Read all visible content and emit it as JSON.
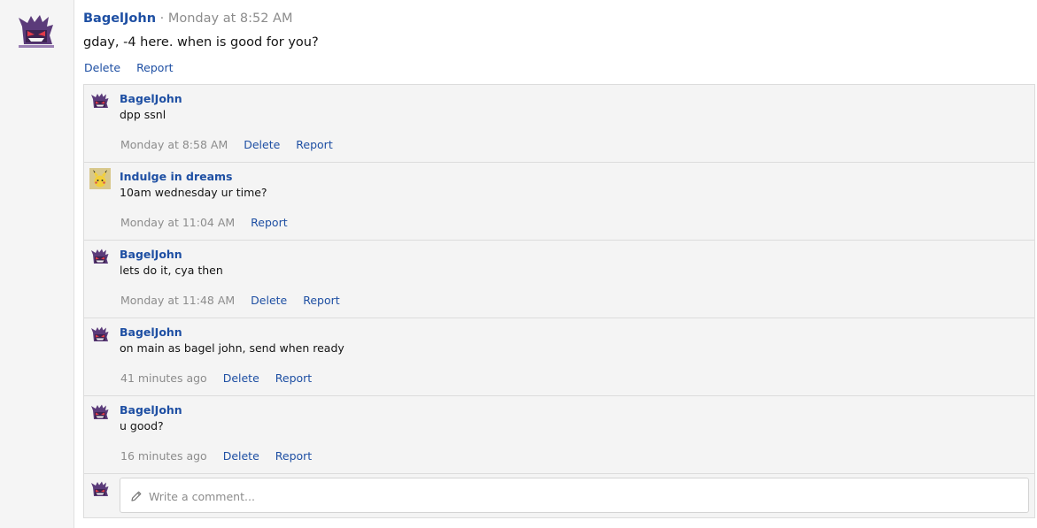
{
  "post": {
    "author": "BagelJohn",
    "separator": " · ",
    "time": "Monday at 8:52 AM",
    "text": "gday, -4 here. when is good for you?",
    "actions": {
      "delete": "Delete",
      "report": "Report"
    }
  },
  "comments": [
    {
      "author": "BagelJohn",
      "avatar": "gengar-icon",
      "text": "dpp ssnl",
      "time": "Monday at 8:58 AM",
      "delete": "Delete",
      "report": "Report"
    },
    {
      "author": "Indulge in dreams",
      "avatar": "pikachu-icon",
      "text": "10am wednesday ur time?",
      "time": "Monday at 11:04 AM",
      "report": "Report"
    },
    {
      "author": "BagelJohn",
      "avatar": "gengar-icon",
      "text": "lets do it, cya then",
      "time": "Monday at 11:48 AM",
      "delete": "Delete",
      "report": "Report"
    },
    {
      "author": "BagelJohn",
      "avatar": "gengar-icon",
      "text": "on main as bagel john, send when ready",
      "time": "41 minutes ago",
      "delete": "Delete",
      "report": "Report"
    },
    {
      "author": "BagelJohn",
      "avatar": "gengar-icon",
      "text": "u good?",
      "time": "16 minutes ago",
      "delete": "Delete",
      "report": "Report"
    }
  ],
  "reply": {
    "placeholder": "Write a comment...",
    "icon": "pencil-icon"
  },
  "colors": {
    "link": "#1e4fa3",
    "muted": "#8c8c8c",
    "panel": "#f4f4f4",
    "border": "#dcdcdc"
  }
}
